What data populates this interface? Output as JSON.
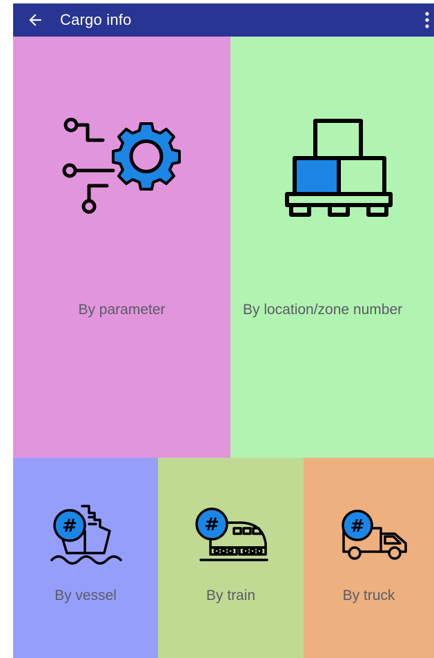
{
  "appbar": {
    "title": "Cargo info",
    "back_icon": "arrow-left-icon",
    "menu_icon": "more-vert-icon",
    "background": "#283593"
  },
  "tiles": [
    {
      "label": "By parameter",
      "icon": "gear-circuit-icon",
      "background": "#e195dc"
    },
    {
      "label": "By location/zone number",
      "icon": "pallet-boxes-icon",
      "background": "#b1f3b1"
    },
    {
      "label": "By vessel",
      "icon": "ship-hash-icon",
      "background": "#959ffb"
    },
    {
      "label": "By train",
      "icon": "train-hash-icon",
      "background": "#c1da93"
    },
    {
      "label": "By truck",
      "icon": "truck-hash-icon",
      "background": "#edb07e"
    }
  ],
  "colors": {
    "accent_blue": "#1b86e6",
    "icon_stroke": "#000000",
    "label_text": "#5b5b66"
  },
  "hash_badge": "#"
}
